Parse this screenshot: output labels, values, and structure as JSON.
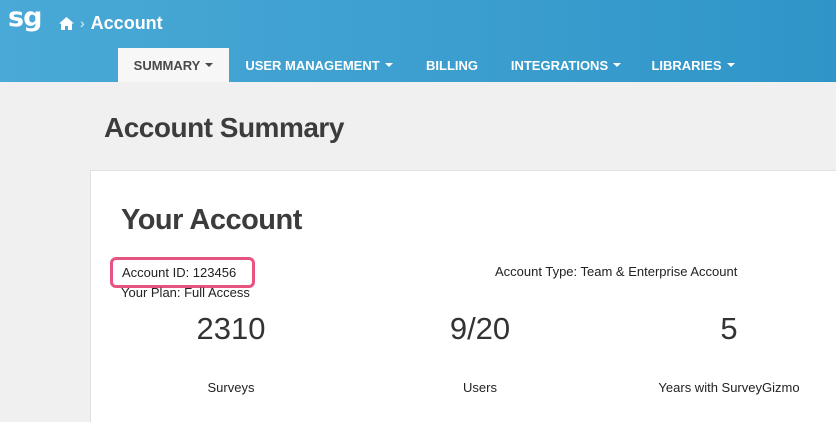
{
  "app": {
    "logo_text": "sg",
    "crumb_title": "Account"
  },
  "nav": {
    "items": [
      {
        "label": "SUMMARY",
        "dropdown": true,
        "active": true
      },
      {
        "label": "USER MANAGEMENT",
        "dropdown": true,
        "active": false
      },
      {
        "label": "BILLING",
        "dropdown": false,
        "active": false
      },
      {
        "label": "INTEGRATIONS",
        "dropdown": true,
        "active": false
      },
      {
        "label": "LIBRARIES",
        "dropdown": true,
        "active": false
      }
    ]
  },
  "page": {
    "title": "Account Summary"
  },
  "account": {
    "card_title": "Your Account",
    "account_id": "Account ID: 123456",
    "account_type": "Account Type: Team & Enterprise Account",
    "plan": "Your Plan: Full Access",
    "stats": [
      {
        "value": "2310",
        "label": "Surveys"
      },
      {
        "value": "9/20",
        "label": "Users"
      },
      {
        "value": "5",
        "label": "Years with SurveyGizmo"
      }
    ]
  },
  "colors": {
    "header": "#3aa0d0",
    "highlight_border": "#e75480",
    "card_bg": "#ffffff",
    "page_bg": "#f0f0f0"
  }
}
